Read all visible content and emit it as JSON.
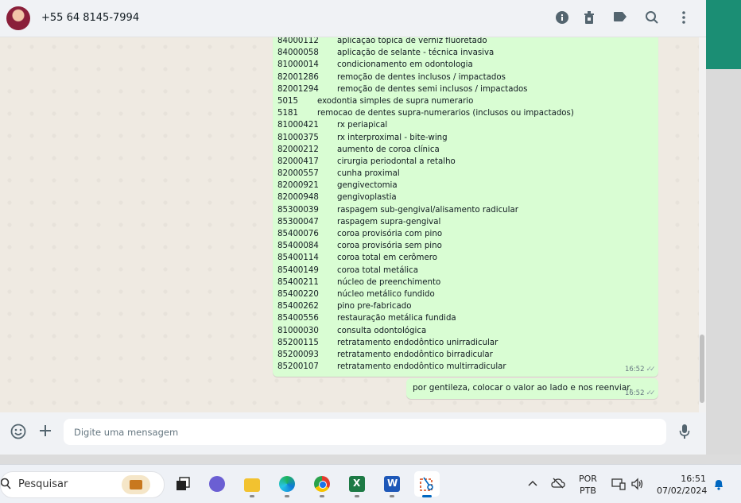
{
  "header": {
    "contact_name": "+55 64 8145-7994",
    "icons": [
      "info-icon",
      "trash-icon",
      "label-icon",
      "search-icon",
      "menu-icon"
    ]
  },
  "messages": {
    "list": {
      "rows": [
        {
          "code": "84000112",
          "desc": "aplicação tópica de verniz fluoretado"
        },
        {
          "code": "84000058",
          "desc": "aplicação de selante - técnica invasiva"
        },
        {
          "code": "81000014",
          "desc": "condicionamento em odontologia"
        },
        {
          "code": "82001286",
          "desc": "remoção de dentes inclusos / impactados"
        },
        {
          "code": "82001294",
          "desc": "remoção de dentes semi inclusos / impactados"
        },
        {
          "code": "5015",
          "desc": "exodontia simples de supra numerario",
          "short": true
        },
        {
          "code": "5181",
          "desc": "remocao de dentes supra-numerarios (inclusos ou impactados)",
          "short": true
        },
        {
          "code": "81000421",
          "desc": "rx periapical"
        },
        {
          "code": "81000375",
          "desc": "rx interproximal - bite-wing"
        },
        {
          "code": "82000212",
          "desc": "aumento de coroa clínica"
        },
        {
          "code": "82000417",
          "desc": "cirurgia periodontal a retalho"
        },
        {
          "code": "82000557",
          "desc": "cunha proximal"
        },
        {
          "code": "82000921",
          "desc": "gengivectomia"
        },
        {
          "code": "82000948",
          "desc": "gengivoplastia"
        },
        {
          "code": "85300039",
          "desc": "raspagem sub-gengival/alisamento radicular"
        },
        {
          "code": "85300047",
          "desc": "raspagem supra-gengival"
        },
        {
          "code": "85400076",
          "desc": "coroa provisória com pino"
        },
        {
          "code": "85400084",
          "desc": "coroa provisória sem pino"
        },
        {
          "code": "85400114",
          "desc": "coroa total em cerômero"
        },
        {
          "code": "85400149",
          "desc": "coroa total metálica"
        },
        {
          "code": "85400211",
          "desc": "núcleo de preenchimento"
        },
        {
          "code": "85400220",
          "desc": "núcleo metálico fundido"
        },
        {
          "code": "85400262",
          "desc": "pino pre-fabricado"
        },
        {
          "code": "85400556",
          "desc": "restauração metálica fundida"
        },
        {
          "code": "81000030",
          "desc": "consulta odontológica"
        },
        {
          "code": "85200115",
          "desc": "retratamento endodôntico unirradicular"
        },
        {
          "code": "85200093",
          "desc": "retratamento endodôntico birradicular"
        },
        {
          "code": "85200107",
          "desc": "retratamento endodôntico multirradicular"
        }
      ],
      "time": "16:52"
    },
    "reply": {
      "text": "por gentileza, colocar o valor ao lado e nos reenviar.",
      "time": "16:52"
    }
  },
  "composer": {
    "placeholder": "Digite uma mensagem",
    "icons": [
      "emoji-icon",
      "plus-icon",
      "microphone-icon"
    ]
  },
  "taskbar": {
    "search_label": "Pesquisar",
    "apps": [
      "task-view",
      "teams",
      "file-explorer",
      "edge",
      "chrome",
      "excel",
      "word",
      "snipping-tool"
    ],
    "active_app": "snipping-tool",
    "language_line1": "POR",
    "language_line2": "PTB",
    "time": "16:51",
    "date": "07/02/2024"
  },
  "colors": {
    "bubble": "#d9fdd3",
    "header": "#f0f2f5",
    "accent": "#1b8e74"
  }
}
